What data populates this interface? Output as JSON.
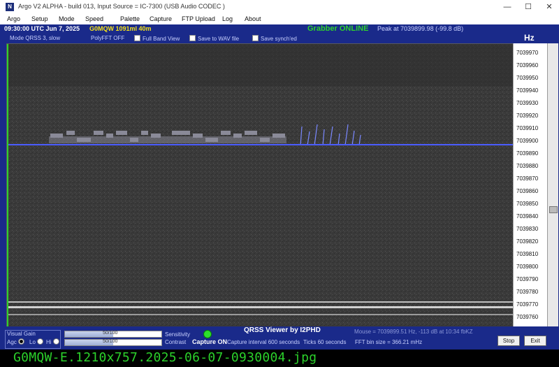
{
  "window": {
    "title": "Argo V2 ALPHA - build 013, Input Source = IC-7300 (USB Audio CODEC )",
    "minimize_glyph": "—",
    "maximize_glyph": "☐",
    "close_glyph": "✕"
  },
  "menu": [
    "Argo",
    "Setup",
    "Mode",
    "Speed",
    "Palette",
    "Capture",
    "FTP Upload",
    "Log",
    "About"
  ],
  "info": {
    "datetime": "09:30:00 UTC   Jun 7, 2025",
    "callsign": "G0MQW 1091ml 40m",
    "grabber": "Grabber ONLINE",
    "peak": "Peak at 7039899.98 (-99.8 dB)"
  },
  "options": {
    "mode": "Mode   QRSS 3, slow",
    "polyfft": "PolyFFT OFF",
    "full_band": "Full Band View",
    "save_wav": "Save to WAV file",
    "save_synch": "Save synch'ed"
  },
  "hz_label": "Hz",
  "freq_scale": [
    "7039970",
    "7039960",
    "7039950",
    "7039940",
    "7039930",
    "7039920",
    "7039910",
    "7039900",
    "7039890",
    "7039880",
    "7039870",
    "7039860",
    "7039850",
    "7039840",
    "7039830",
    "7039820",
    "7039810",
    "7039800",
    "7039790",
    "7039780",
    "7039770",
    "7039760"
  ],
  "bottom": {
    "visual_gain": "Visual Gain",
    "agc": "Agc",
    "lo": "Lo",
    "hi": "Hi",
    "gain1": "50/100",
    "gain2": "50/100",
    "sensitivity": "Sensitivity",
    "contrast": "Contrast",
    "capture": "Capture ON",
    "capture_interval": "Capture interval 600 seconds",
    "ticks": "Ticks  60 seconds",
    "qrss_title": "QRSS Viewer by I2PHD",
    "mouse": "Mouse = 7039899.51 Hz, -113 dB at 10:34 fbKZ",
    "fft_bin": "FFT bin size = 366.21 mHz",
    "stop": "Stop",
    "exit": "Exit"
  },
  "filename_strip": "G0MQW-E.1210x757.2025-06-07-0930004.jpg",
  "colors": {
    "window_bg": "#1a2a8a",
    "grabber_online": "#2ed12e",
    "callsign_yellow": "#f5e21a",
    "waterfall_bg": "#3a3a3a",
    "signal_line": "#4a5cff",
    "strip_text": "#2bd12b"
  }
}
